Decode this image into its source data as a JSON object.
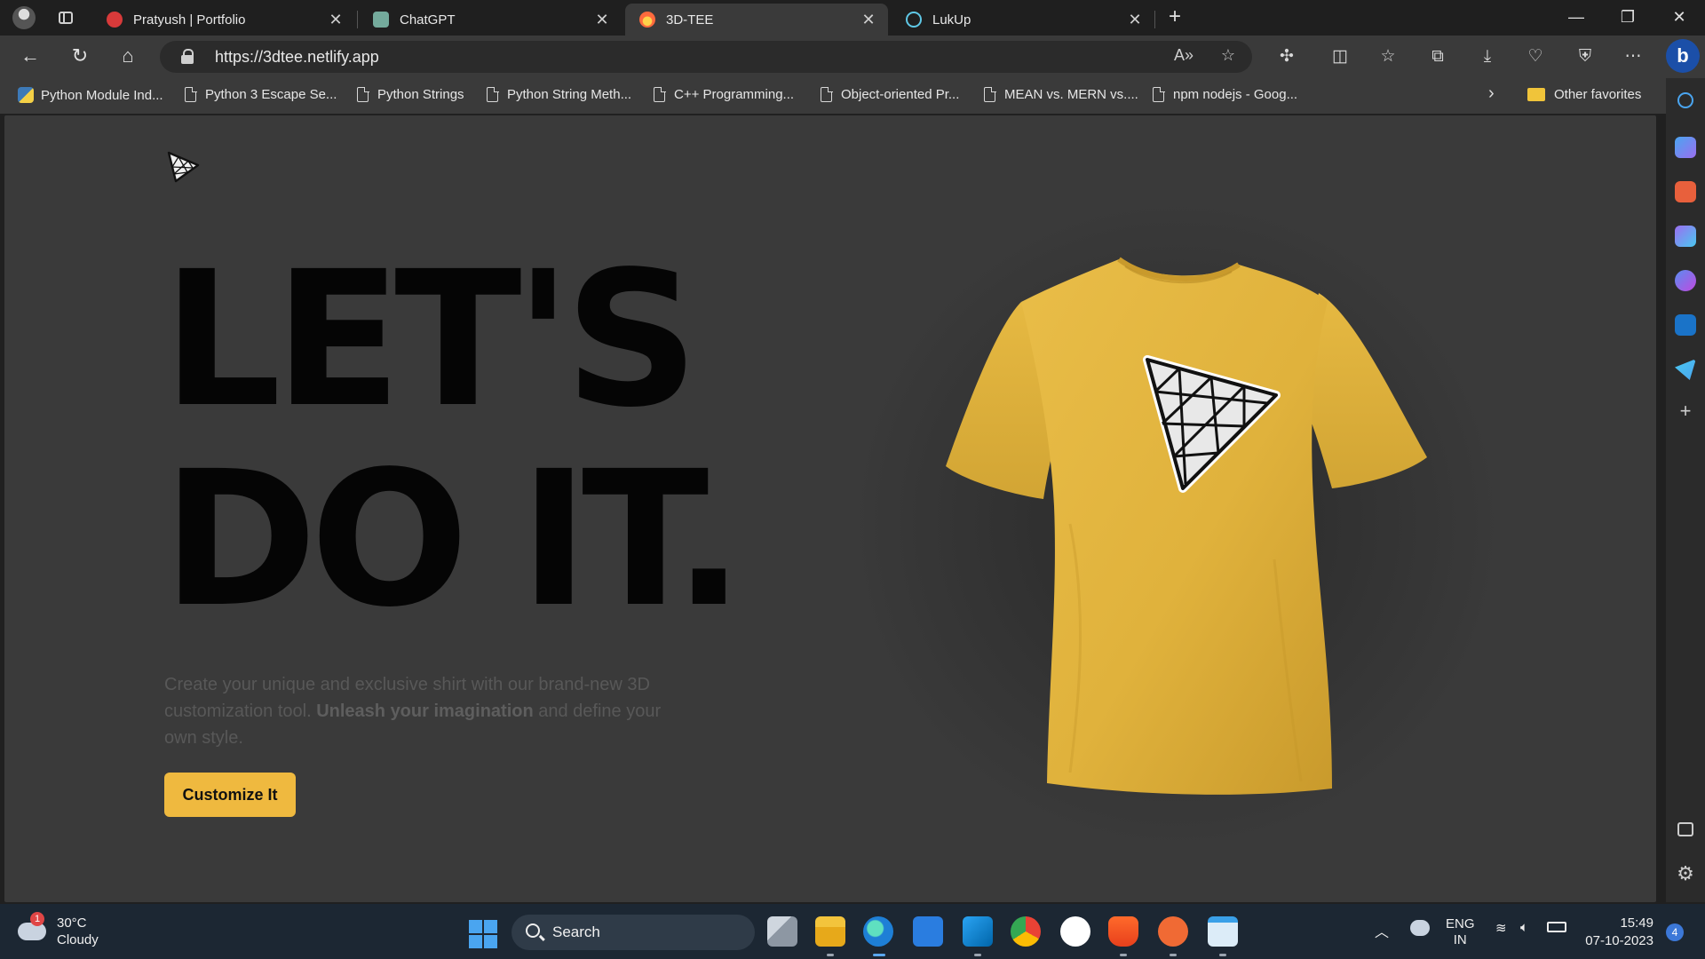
{
  "browser": {
    "tabs": [
      {
        "title": "Pratyush | Portfolio",
        "active": false
      },
      {
        "title": "ChatGPT",
        "active": false
      },
      {
        "title": "3D-TEE",
        "active": true
      },
      {
        "title": "LukUp",
        "active": false
      }
    ],
    "url": "https://3dtee.netlify.app",
    "favorites": [
      "Python Module Ind...",
      "Python 3 Escape Se...",
      "Python Strings",
      "Python String Meth...",
      "C++ Programming...",
      "Object-oriented Pr...",
      "MEAN vs. MERN vs....",
      "npm nodejs - Goog..."
    ],
    "other_favorites": "Other favorites",
    "accent_color": "#1b4fa8"
  },
  "page": {
    "headline_line1": "LET'S",
    "headline_line2": "DO IT.",
    "description_part1": "Create your unique and exclusive shirt with our brand-new 3D customization tool.",
    "description_bold": "Unleash your imagination",
    "description_part2": "and define your own style.",
    "cta_label": "Customize It",
    "shirt_color": "#e3b53e",
    "cta_color": "#efb93f"
  },
  "taskbar": {
    "weather_temp": "30°C",
    "weather_condition": "Cloudy",
    "weather_badge": "1",
    "search_label": "Search",
    "lang_line1": "ENG",
    "lang_line2": "IN",
    "time": "15:49",
    "date": "07-10-2023",
    "notification_count": "4"
  }
}
